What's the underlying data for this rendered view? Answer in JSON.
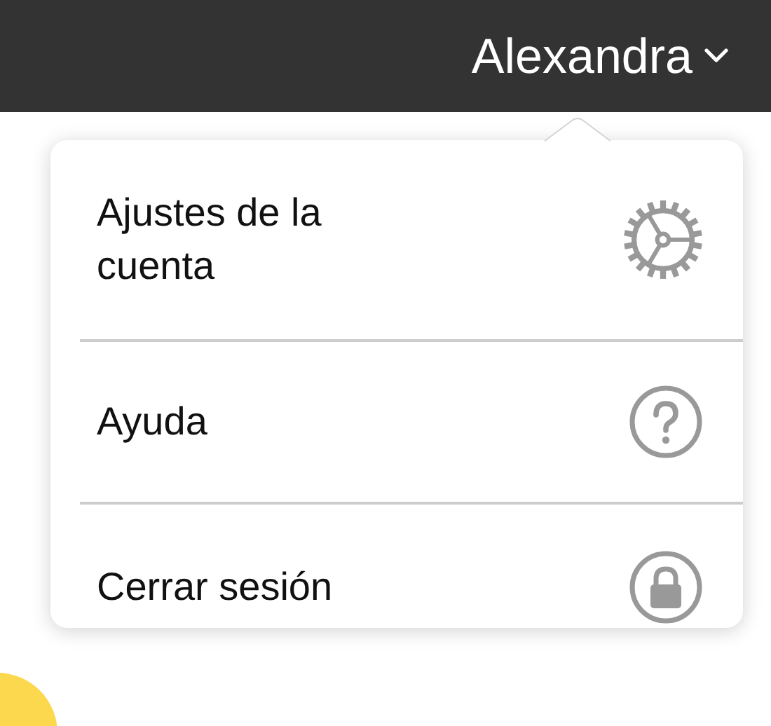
{
  "top_bar": {
    "user_name": "Alexandra"
  },
  "account_menu": {
    "items": [
      {
        "label": "Ajustes de la cuenta",
        "kind": "settings"
      },
      {
        "label": "Ayuda",
        "kind": "help"
      },
      {
        "label": "Cerrar sesión",
        "kind": "logout"
      }
    ]
  }
}
